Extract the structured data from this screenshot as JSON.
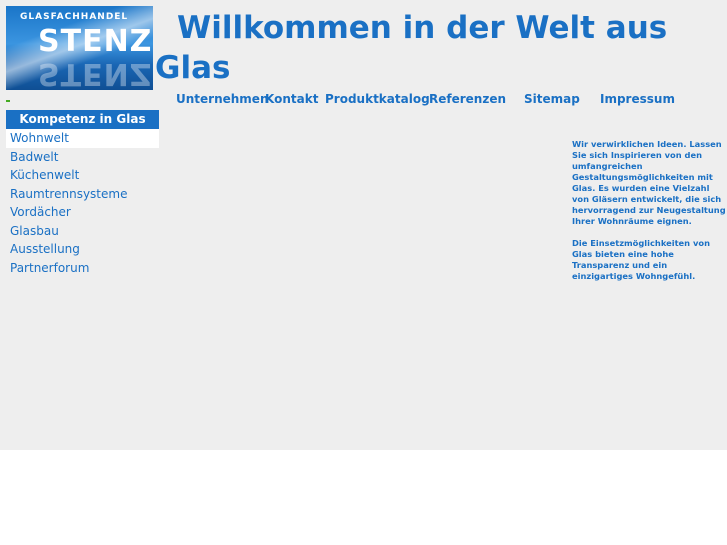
{
  "logo": {
    "small_text": "GLASFACHHANDEL",
    "big_text": "STENZ"
  },
  "headline": "Willkommen in der Welt aus Glas",
  "top_nav": [
    {
      "label": "Unternehmen"
    },
    {
      "label": "Kontakt"
    },
    {
      "label": "Produktkatalog"
    },
    {
      "label": "Referenzen"
    },
    {
      "label": "Sitemap"
    },
    {
      "label": "Impressum"
    }
  ],
  "sidebar": {
    "header": "Kompetenz in Glas",
    "items": [
      {
        "label": "Wohnwelt"
      },
      {
        "label": "Badwelt"
      },
      {
        "label": "Küchenwelt"
      },
      {
        "label": "Raumtrennsysteme"
      },
      {
        "label": "Vordächer"
      },
      {
        "label": "Glasbau"
      },
      {
        "label": "Ausstellung"
      },
      {
        "label": "Partnerforum"
      }
    ]
  },
  "content": {
    "paragraph1": "Wir verwirklichen Ideen. Lassen Sie sich Inspirieren von den umfangreichen Gestaltungsmöglichkeiten mit Glas. Es wurden eine Vielzahl von Gläsern entwickelt, die sich hervorragend zur Neugestaltung Ihrer Wohnräume eignen.",
    "paragraph2": "Die Einsetzmöglichkeiten von Glas bieten eine hohe Transparenz und ein einzigartiges Wohngefühl."
  },
  "colors": {
    "accent": "#1a70c4",
    "background": "#eeeeee"
  }
}
